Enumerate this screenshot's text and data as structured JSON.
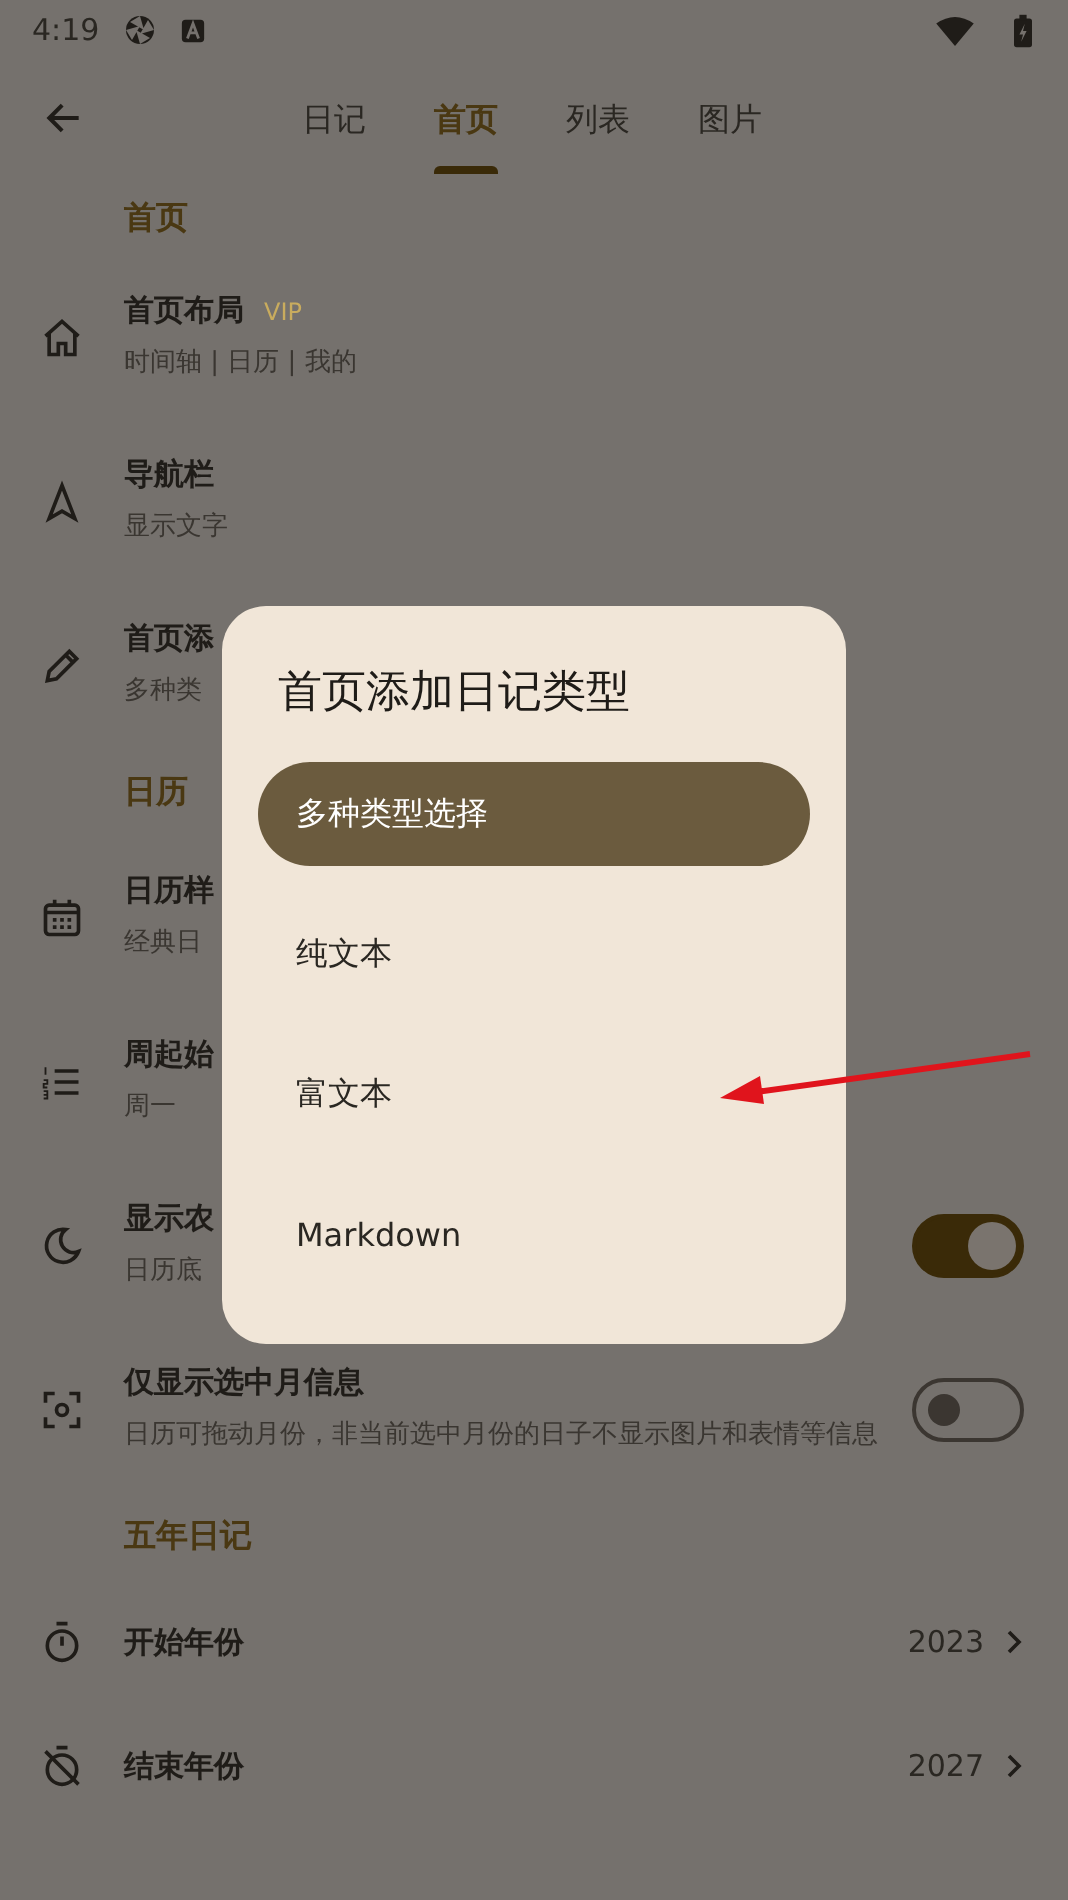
{
  "status_bar": {
    "time": "4:19"
  },
  "tabs": [
    {
      "label": "日记",
      "selected": false
    },
    {
      "label": "首页",
      "selected": true
    },
    {
      "label": "列表",
      "selected": false
    },
    {
      "label": "图片",
      "selected": false
    }
  ],
  "sections": [
    {
      "title": "首页",
      "items": [
        {
          "kind": "plain",
          "title": "首页布局",
          "badge": "VIP",
          "subtitle": "时间轴 | 日历 | 我的"
        },
        {
          "kind": "plain",
          "title": "导航栏",
          "subtitle": "显示文字"
        },
        {
          "kind": "plain",
          "title": "首页添",
          "subtitle": "多种类"
        }
      ]
    },
    {
      "title": "日历",
      "items": [
        {
          "kind": "plain",
          "title": "日历样",
          "subtitle": "经典日"
        },
        {
          "kind": "plain",
          "title": "周起始",
          "subtitle": "周一"
        },
        {
          "kind": "toggle",
          "title": "显示农",
          "subtitle": "日历底",
          "on": true
        },
        {
          "kind": "toggle",
          "title": "仅显示选中月信息",
          "subtitle": "日历可拖动月份，非当前选中月份的日子不显示图片和表情等信息",
          "on": false
        }
      ]
    },
    {
      "title": "五年日记",
      "items": [
        {
          "kind": "value",
          "title": "开始年份",
          "value": "2023"
        },
        {
          "kind": "value",
          "title": "结束年份",
          "value": "2027"
        }
      ]
    }
  ],
  "dialog": {
    "title": "首页添加日记类型",
    "options": [
      {
        "label": "多种类型选择",
        "selected": true
      },
      {
        "label": "纯文本",
        "selected": false
      },
      {
        "label": "富文本",
        "selected": false
      },
      {
        "label": "Markdown",
        "selected": false
      }
    ]
  }
}
